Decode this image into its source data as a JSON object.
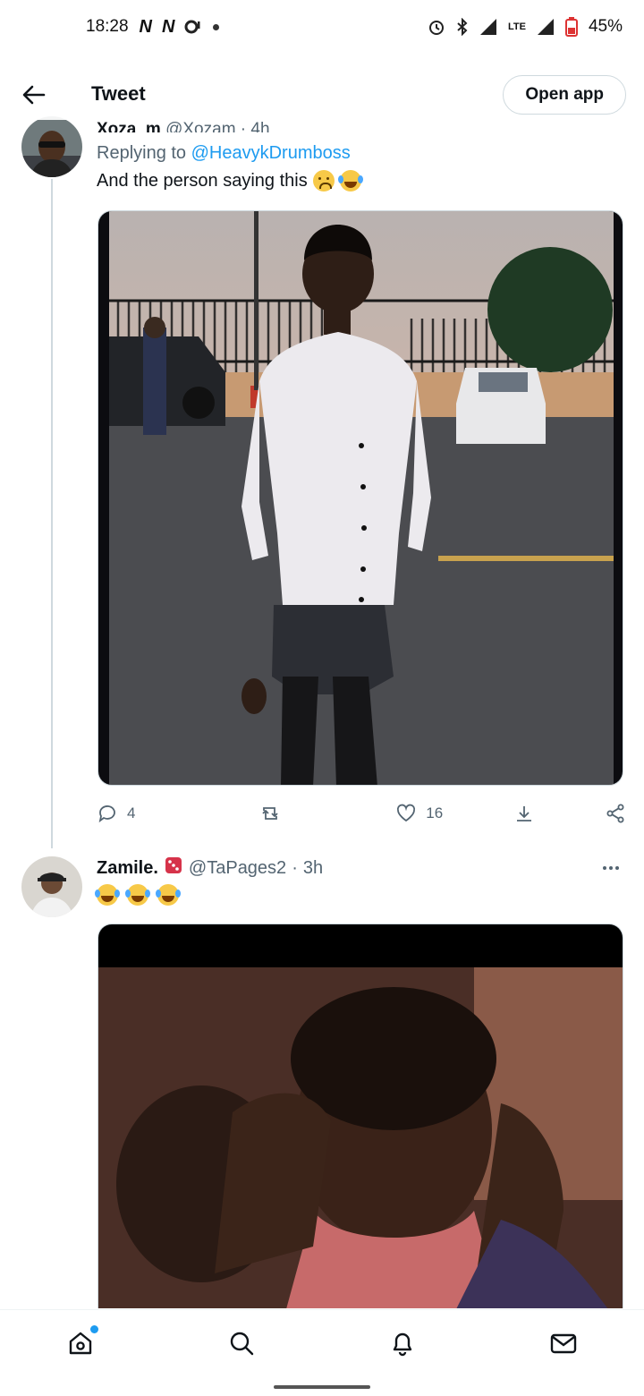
{
  "status_bar": {
    "time": "18:28",
    "carrier_icons": [
      "N",
      "N"
    ],
    "network": "LTE",
    "battery": "45%"
  },
  "header": {
    "title": "Tweet",
    "open_app_label": "Open app"
  },
  "tweet1": {
    "display_name_clipped": "Xoza_m",
    "handle_clipped": "@Xozam · 4h",
    "replying_prefix": "Replying to",
    "replying_mention": "@HeavykDrumboss",
    "text": "And the person saying this",
    "emojis": [
      "sad-face-emoji",
      "tears-of-joy-emoji"
    ],
    "replies": "4",
    "retweets": "",
    "likes": "16"
  },
  "tweet2": {
    "display_name": "Zamile.",
    "badge_icon": "dice-icon",
    "handle": "@TaPages2",
    "separator": "·",
    "time": "3h",
    "emojis": [
      "tears-of-joy-emoji",
      "tears-of-joy-emoji",
      "tears-of-joy-emoji"
    ]
  },
  "bottom_nav": {
    "items": [
      "home-icon",
      "search-icon",
      "notifications-icon",
      "messages-icon"
    ]
  },
  "colors": {
    "accent": "#1d9bf0",
    "text_primary": "#0f1419",
    "text_secondary": "#536471"
  }
}
